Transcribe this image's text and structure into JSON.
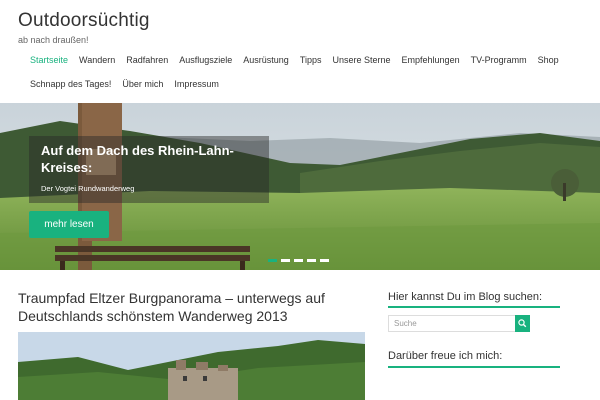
{
  "site": {
    "title": "Outdoorsüchtig",
    "tagline": "ab nach draußen!"
  },
  "nav": {
    "row1": [
      "Startseite",
      "Wandern",
      "Radfahren",
      "Ausflugsziele",
      "Ausrüstung",
      "Tipps",
      "Unsere Sterne",
      "Empfehlungen",
      "TV-Programm",
      "Shop"
    ],
    "row2": [
      "Schnapp des Tages!",
      "Über mich",
      "Impressum"
    ],
    "active": "Startseite"
  },
  "hero": {
    "title": "Auf dem Dach des Rhein-Lahn-Kreises:",
    "subtitle": "Der Vogtei Rundwanderweg",
    "button": "mehr lesen",
    "slides": 5,
    "active_slide": 1
  },
  "post": {
    "title": "Traumpfad Eltzer Burgpanorama – unterwegs auf Deutschlands schönstem Wanderweg 2013"
  },
  "sidebar": {
    "search_title": "Hier kannst Du im Blog suchen:",
    "search_placeholder": "Suche",
    "donate_title": "Darüber freue ich mich:"
  },
  "colors": {
    "accent": "#19b27f",
    "text": "#333333"
  },
  "icons": {
    "search": "search-icon"
  }
}
